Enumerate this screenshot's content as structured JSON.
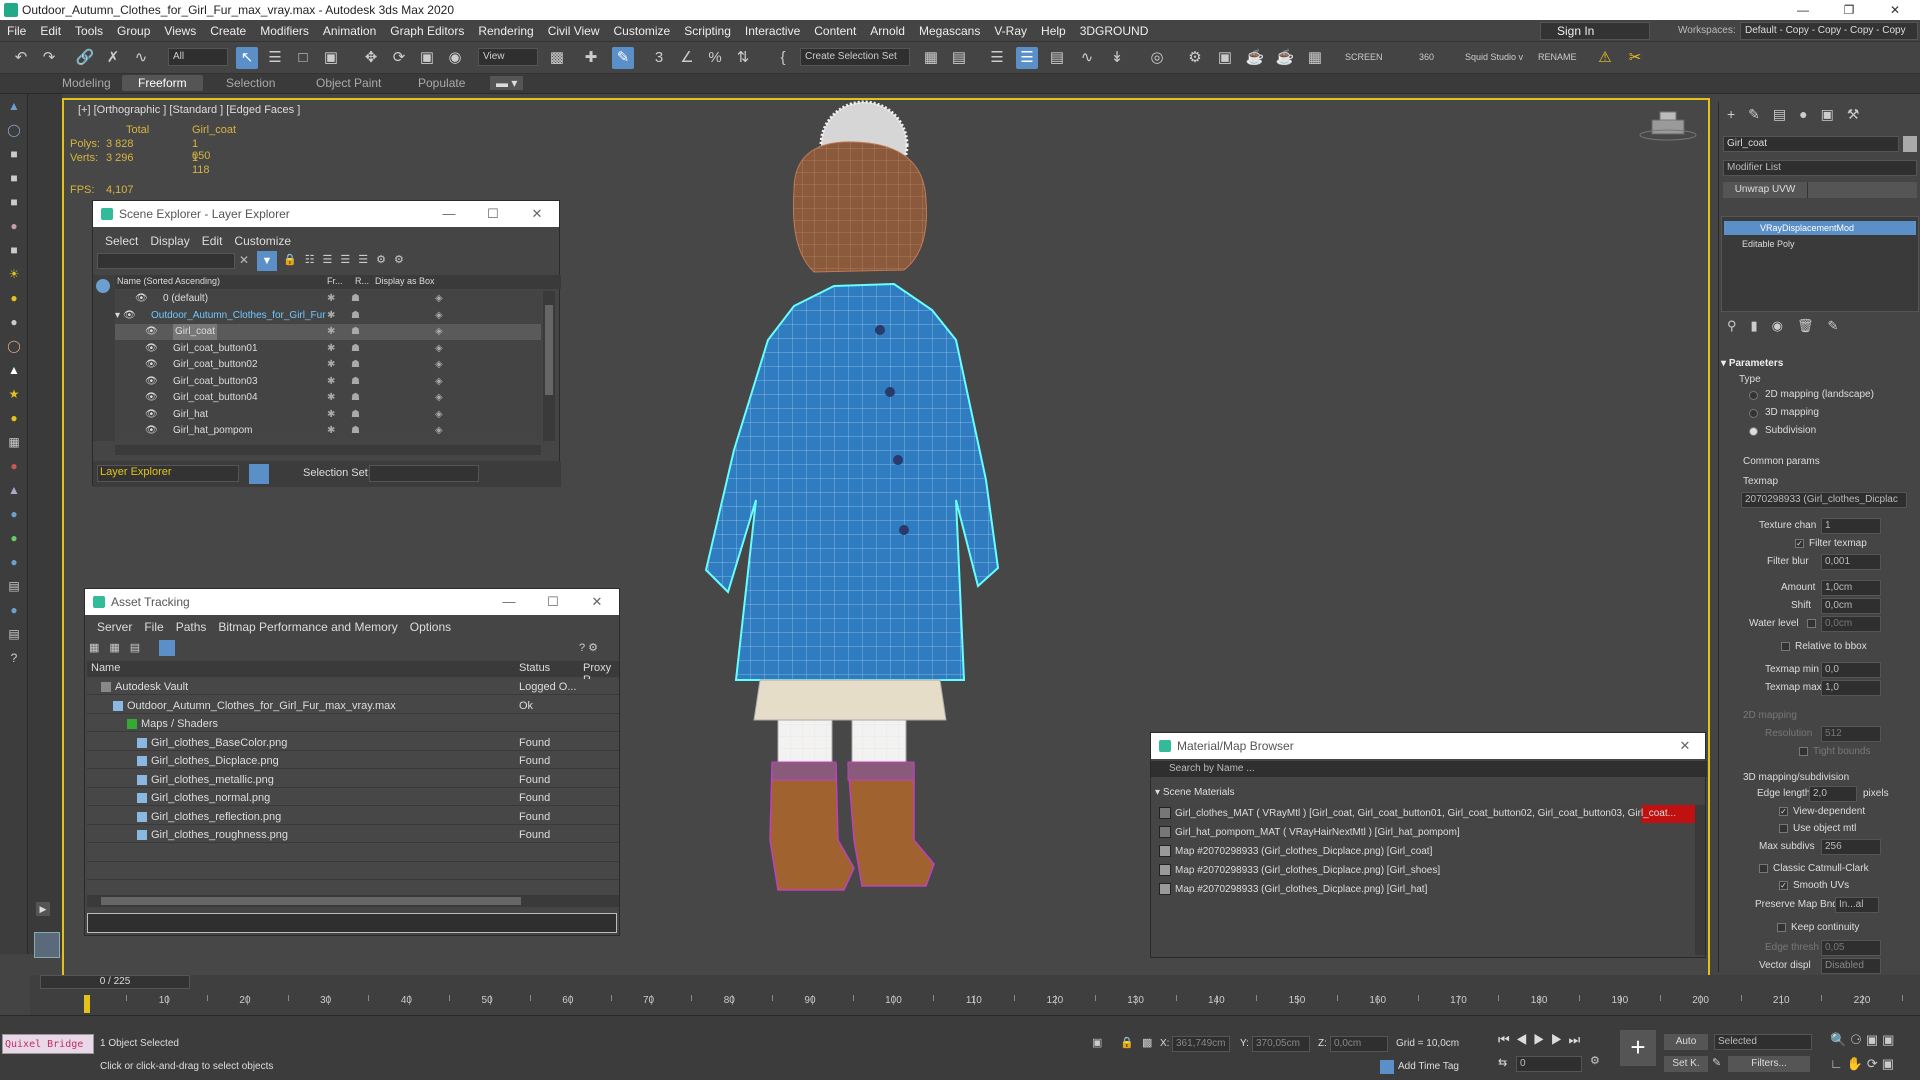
{
  "window": {
    "title": "Outdoor_Autumn_Clothes_for_Girl_Fur_max_vray.max - Autodesk 3ds Max 2020"
  },
  "menu": [
    "File",
    "Edit",
    "Tools",
    "Group",
    "Views",
    "Create",
    "Modifiers",
    "Animation",
    "Graph Editors",
    "Rendering",
    "Civil View",
    "Customize",
    "Scripting",
    "Interactive",
    "Content",
    "Arnold",
    "Megascans",
    "V-Ray",
    "Help",
    "3DGROUND"
  ],
  "signin": "Sign In",
  "workspaces": {
    "label": "Workspaces:",
    "value": "Default - Copy - Copy - Copy - Copy"
  },
  "toolbar": {
    "filter": "All",
    "view": "View",
    "selection_set": "Create Selection Set",
    "screen": "SCREEN",
    "n360": "360",
    "squid": "Squid Studio v",
    "rename": "RENAME"
  },
  "ribbon": {
    "tabs": [
      "Modeling",
      "Freeform",
      "Selection",
      "Object Paint",
      "Populate"
    ]
  },
  "viewport": {
    "label": "[+] [Orthographic ] [Standard ] [Edged Faces ]",
    "stats": {
      "total_h": "Total",
      "obj_h": "Girl_coat",
      "polys_l": "Polys:",
      "polys_t": "3 828",
      "polys_o": "1 050",
      "verts_l": "Verts:",
      "verts_t": "3 296",
      "verts_o": "1 118",
      "fps_l": "FPS:",
      "fps_v": "4,107"
    }
  },
  "scene_explorer": {
    "title": "Scene Explorer - Layer Explorer",
    "menu": [
      "Select",
      "Display",
      "Edit",
      "Customize"
    ],
    "col_name": "Name (Sorted Ascending)",
    "col_fr": "Fr...",
    "col_r": "R...",
    "col_box": "Display as Box",
    "rows": [
      "0 (default)",
      "Outdoor_Autumn_Clothes_for_Girl_Fur",
      "Girl_coat",
      "Girl_coat_button01",
      "Girl_coat_button02",
      "Girl_coat_button03",
      "Girl_coat_button04",
      "Girl_hat",
      "Girl_hat_pompom"
    ],
    "footer_left": "Layer Explorer",
    "footer_sel": "Selection Set:"
  },
  "asset_tracking": {
    "title": "Asset Tracking",
    "menu": [
      "Server",
      "File",
      "Paths",
      "Bitmap Performance and Memory",
      "Options"
    ],
    "col_name": "Name",
    "col_status": "Status",
    "col_proxy": "Proxy R",
    "rows": [
      {
        "name": "Autodesk Vault",
        "status": "Logged O..."
      },
      {
        "name": "Outdoor_Autumn_Clothes_for_Girl_Fur_max_vray.max",
        "status": "Ok"
      },
      {
        "name": "Maps / Shaders",
        "status": ""
      },
      {
        "name": "Girl_clothes_BaseColor.png",
        "status": "Found"
      },
      {
        "name": "Girl_clothes_Dicplace.png",
        "status": "Found"
      },
      {
        "name": "Girl_clothes_metallic.png",
        "status": "Found"
      },
      {
        "name": "Girl_clothes_normal.png",
        "status": "Found"
      },
      {
        "name": "Girl_clothes_reflection.png",
        "status": "Found"
      },
      {
        "name": "Girl_clothes_roughness.png",
        "status": "Found"
      }
    ]
  },
  "material_browser": {
    "title": "Material/Map Browser",
    "search": "Search by Name ...",
    "section": "Scene Materials",
    "rows": [
      "Girl_clothes_MAT  ( VRayMtl )  [Girl_coat, Girl_coat_button01, Girl_coat_button02, Girl_coat_button03, Girl_coat...",
      "Girl_hat_pompom_MAT  ( VRayHairNextMtl )  [Girl_hat_pompom]",
      "Map #2070298933 (Girl_clothes_Dicplace.png)  [Girl_coat]",
      "Map #2070298933 (Girl_clothes_Dicplace.png)  [Girl_shoes]",
      "Map #2070298933 (Girl_clothes_Dicplace.png)  [Girl_hat]"
    ]
  },
  "command_panel": {
    "object_name": "Girl_coat",
    "modifier_list": "Modifier List",
    "unwrap": "Unwrap UVW",
    "stack": [
      "VRayDisplacementMod",
      "Editable Poly"
    ],
    "params_title": "Parameters",
    "type_label": "Type",
    "type_opts": [
      "2D mapping (landscape)",
      "3D mapping",
      "Subdivision"
    ],
    "common": "Common params",
    "texmap": "Texmap",
    "texmap_val": "2070298933 (Girl_clothes_Dicplac",
    "texture_chan": "Texture chan",
    "texture_chan_v": "1",
    "filter_texmap": "Filter texmap",
    "filter_blur": "Filter blur",
    "filter_blur_v": "0,001",
    "amount": "Amount",
    "amount_v": "1,0cm",
    "shift": "Shift",
    "shift_v": "0,0cm",
    "water": "Water level",
    "water_v": "0,0cm",
    "relative": "Relative to bbox",
    "tmin": "Texmap min",
    "tmin_v": "0,0",
    "tmax": "Texmap max",
    "tmax_v": "1,0",
    "m2d": "2D mapping",
    "resolution": "Resolution",
    "resolution_v": "512",
    "tight": "Tight bounds",
    "m3d": "3D mapping/subdivision",
    "edge_len": "Edge length",
    "edge_len_v": "2,0",
    "pixels": "pixels",
    "view_dep": "View-dependent",
    "use_obj": "Use object mtl",
    "max_sub": "Max subdivs",
    "max_sub_v": "256",
    "catmull": "Classic Catmull-Clark",
    "smooth_uv": "Smooth UVs",
    "preserve": "Preserve Map Bnd",
    "preserve_v": "In...al",
    "keep": "Keep continuity",
    "edge_thresh": "Edge thresh",
    "edge_thresh_v": "0,05",
    "vector": "Vector displ",
    "vector_v": "Disabled"
  },
  "timeline": {
    "frame": "0 / 225",
    "ticks": [
      "0",
      "10",
      "20",
      "30",
      "40",
      "50",
      "60",
      "70",
      "80",
      "90",
      "100",
      "110",
      "120",
      "130",
      "140",
      "150",
      "160",
      "170",
      "180",
      "190",
      "200",
      "210",
      "220"
    ]
  },
  "status": {
    "quixel": "Quixel Bridge",
    "selected": "1 Object Selected",
    "hint": "Click or click-and-drag to select objects",
    "x_l": "X:",
    "x_v": "361,749cm",
    "y_l": "Y:",
    "y_v": "370,05cm",
    "z_l": "Z:",
    "z_v": "0,0cm",
    "grid": "Grid = 10,0cm",
    "add_tag": "Add Time Tag",
    "auto": "Auto",
    "sel_dd": "Selected",
    "setk": "Set K.",
    "filters": "Filters...",
    "frame_v": "0"
  }
}
